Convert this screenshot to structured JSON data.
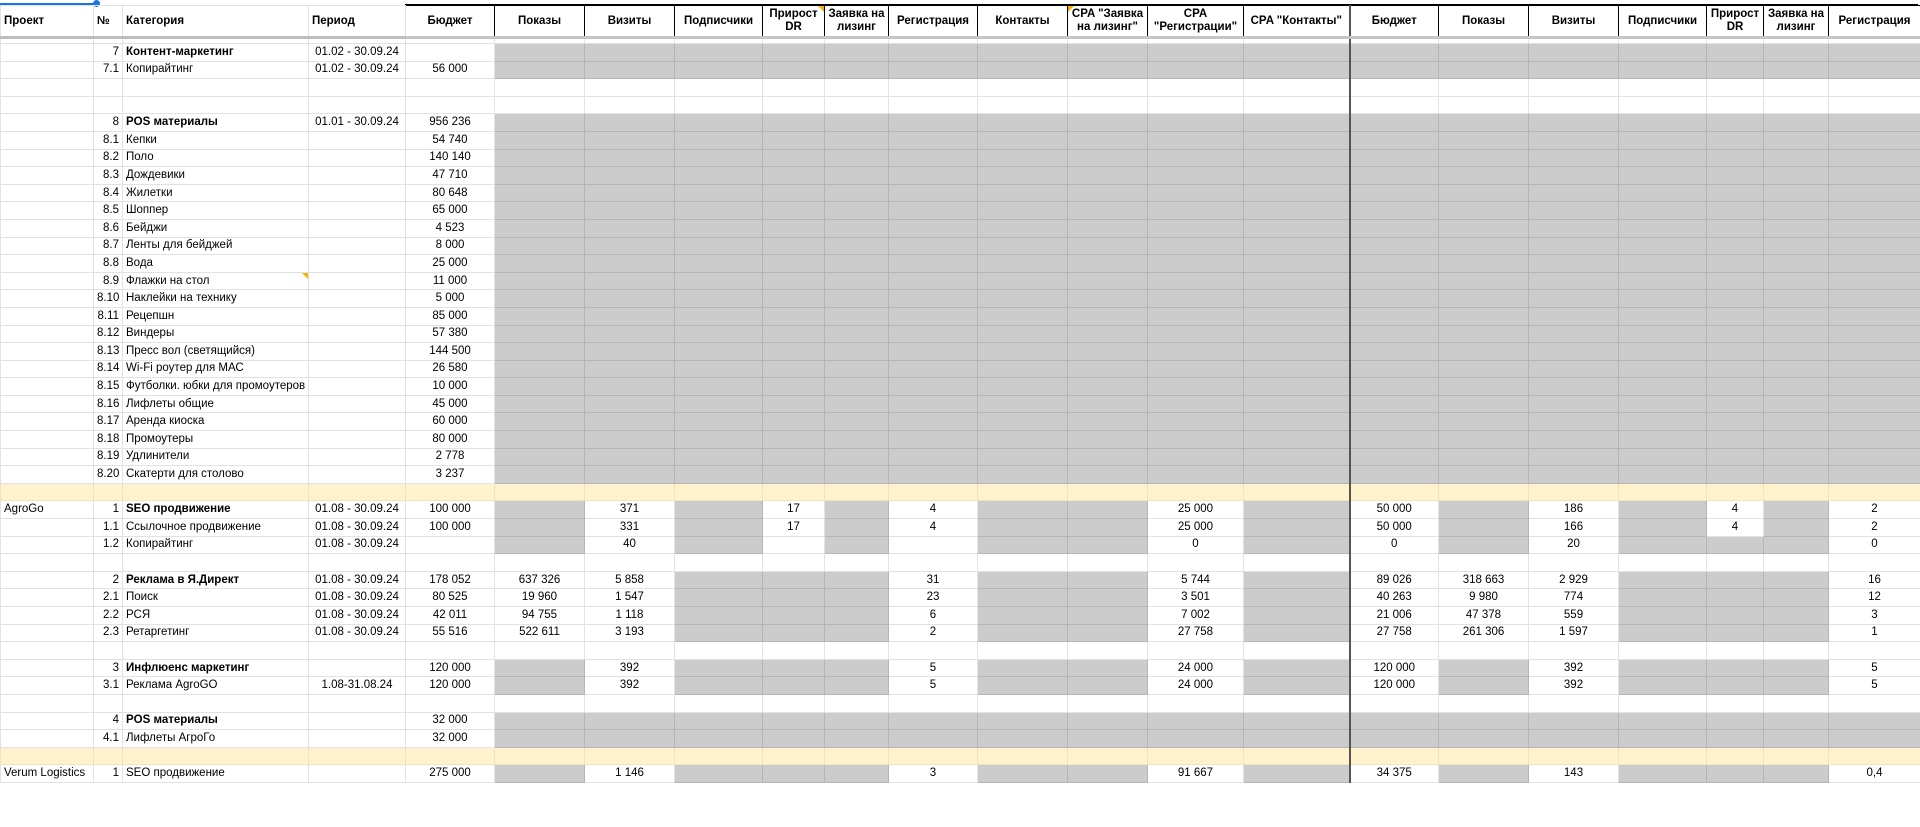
{
  "colors": {
    "shaded": "#cccccc",
    "separator": "#fff2cc",
    "selection": "#1a73e8"
  },
  "header": [
    "Проект",
    "№",
    "Категория",
    "Период",
    "Бюджет",
    "Показы",
    "Визиты",
    "Подписчики",
    "Прирост DR",
    "Заявка на лизинг",
    "Регистрация",
    "Контакты",
    "CPA \"Заявка на лизинг\"",
    "CPA \"Регистрации\"",
    "CPA \"Контакты\"",
    "Бюджет",
    "Показы",
    "Визиты",
    "Подписчики",
    "Прирост DR",
    "Заявка на лизинг",
    "Регистрация"
  ],
  "rows": [
    {
      "s": "wwwwwggggggggggggggggg",
      "b": true,
      "c": [
        "",
        "7",
        "Контент-маркетинг",
        "01.02 - 30.09.24",
        ""
      ]
    },
    {
      "s": "wwwwwggggggggggggggggg",
      "c": [
        "",
        "7.1",
        "Копирайтинг",
        "01.02 - 30.09.24",
        "56 000"
      ]
    },
    {
      "s": "wwwwwwwwwwwwwwwwwwwwww",
      "c": []
    },
    {
      "s": "wwwwwwwwwwwwwwwwwwwwww",
      "c": []
    },
    {
      "s": "wwwwwggggggggggggggggg",
      "b": true,
      "c": [
        "",
        "8",
        "POS материалы",
        "01.01 - 30.09.24",
        "956 236"
      ]
    },
    {
      "s": "wwwwwggggggggggggggggg",
      "c": [
        "",
        "8.1",
        "Кепки",
        "",
        "54 740"
      ]
    },
    {
      "s": "wwwwwggggggggggggggggg",
      "c": [
        "",
        "8.2",
        "Поло",
        "",
        "140 140"
      ]
    },
    {
      "s": "wwwwwggggggggggggggggg",
      "c": [
        "",
        "8.3",
        "Дождевики",
        "",
        "47 710"
      ]
    },
    {
      "s": "wwwwwggggggggggggggggg",
      "c": [
        "",
        "8.4",
        "Жилетки",
        "",
        "80 648"
      ]
    },
    {
      "s": "wwwwwggggggggggggggggg",
      "c": [
        "",
        "8.5",
        "Шоппер",
        "",
        "65 000"
      ]
    },
    {
      "s": "wwwwwggggggggggggggggg",
      "c": [
        "",
        "8.6",
        "Бейджи",
        "",
        "4 523"
      ]
    },
    {
      "s": "wwwwwggggggggggggggggg",
      "c": [
        "",
        "8.7",
        "Ленты для бейджей",
        "",
        "8 000"
      ]
    },
    {
      "s": "wwwwwggggggggggggggggg",
      "c": [
        "",
        "8.8",
        "Вода",
        "",
        "25 000"
      ]
    },
    {
      "s": "wwwwwggggggggggggggggg",
      "note": 2,
      "c": [
        "",
        "8.9",
        "Флажки на стол",
        "",
        "11 000"
      ]
    },
    {
      "s": "wwwwwggggggggggggggggg",
      "c": [
        "",
        "8.10",
        "Наклейки на технику",
        "",
        "5 000"
      ]
    },
    {
      "s": "wwwwwggggggggggggggggg",
      "c": [
        "",
        "8.11",
        "Рецепшн",
        "",
        "85 000"
      ]
    },
    {
      "s": "wwwwwggggggggggggggggg",
      "c": [
        "",
        "8.12",
        "Виндеры",
        "",
        "57 380"
      ]
    },
    {
      "s": "wwwwwggggggggggggggggg",
      "c": [
        "",
        "8.13",
        "Пресс вол (светящийся)",
        "",
        "144 500"
      ]
    },
    {
      "s": "wwwwwggggggggggggggggg",
      "c": [
        "",
        "8.14",
        "Wi-Fi роутер для МАС",
        "",
        "26 580"
      ]
    },
    {
      "s": "wwwwwggggggggggggggggg",
      "c": [
        "",
        "8.15",
        "Футболки. юбки для промоутеров",
        "",
        "10 000"
      ]
    },
    {
      "s": "wwwwwggggggggggggggggg",
      "c": [
        "",
        "8.16",
        "Лифлеты общие",
        "",
        "45 000"
      ]
    },
    {
      "s": "wwwwwggggggggggggggggg",
      "c": [
        "",
        "8.17",
        "Аренда киоска",
        "",
        "60 000"
      ]
    },
    {
      "s": "wwwwwggggggggggggggggg",
      "c": [
        "",
        "8.18",
        "Промоутеры",
        "",
        "80 000"
      ]
    },
    {
      "s": "wwwwwggggggggggggggggg",
      "c": [
        "",
        "8.19",
        "Удлинители",
        "",
        "2 778"
      ]
    },
    {
      "s": "wwwwwggggggggggggggggg",
      "c": [
        "",
        "8.20",
        "Скатерти для столово",
        "",
        "3 237"
      ]
    },
    {
      "s": "yyyyyyyyyyyyyyyyyyyyyy",
      "c": []
    },
    {
      "s": "wwwwwgwgwgwggwgwgwgwgw",
      "b": true,
      "c": [
        "AgroGo",
        "1",
        "SEO продвижение",
        "01.08 - 30.09.24",
        "100 000",
        "",
        "371",
        "",
        "17",
        "",
        "4",
        "",
        "",
        "25 000",
        "",
        "50 000",
        "",
        "186",
        "",
        "4",
        "",
        "2"
      ]
    },
    {
      "s": "wwwwwgwgwgwggwgwgwgwgw",
      "c": [
        "",
        "1.1",
        "Ссылочное продвижение",
        "01.08 - 30.09.24",
        "100 000",
        "",
        "331",
        "",
        "17",
        "",
        "4",
        "",
        "",
        "25 000",
        "",
        "50 000",
        "",
        "166",
        "",
        "4",
        "",
        "2"
      ]
    },
    {
      "s": "wwwwwgwgwgwggwgwgwgggw",
      "c": [
        "",
        "1.2",
        "Копирайтинг",
        "01.08 - 30.09.24",
        "",
        "",
        "40",
        "",
        "",
        "",
        "",
        "",
        "",
        "0",
        "",
        "0",
        "",
        "20",
        "",
        "",
        "",
        "0"
      ]
    },
    {
      "s": "wwwwwwwwwwwwwwwwwwwwww",
      "c": []
    },
    {
      "s": "wwwwwwwgggwggwgwwwgggw",
      "b": true,
      "c": [
        "",
        "2",
        "Реклама в Я.Директ",
        "01.08 - 30.09.24",
        "178 052",
        "637 326",
        "5 858",
        "",
        "",
        "",
        "31",
        "",
        "",
        "5 744",
        "",
        "89 026",
        "318 663",
        "2 929",
        "",
        "",
        "",
        "16"
      ]
    },
    {
      "s": "wwwwwwwgggwggwgwwwgggw",
      "c": [
        "",
        "2.1",
        "Поиск",
        "01.08 - 30.09.24",
        "80 525",
        "19 960",
        "1 547",
        "",
        "",
        "",
        "23",
        "",
        "",
        "3 501",
        "",
        "40 263",
        "9 980",
        "774",
        "",
        "",
        "",
        "12"
      ]
    },
    {
      "s": "wwwwwwwgggwggwgwwwgggw",
      "c": [
        "",
        "2.2",
        "РСЯ",
        "01.08 - 30.09.24",
        "42 011",
        "94 755",
        "1 118",
        "",
        "",
        "",
        "6",
        "",
        "",
        "7 002",
        "",
        "21 006",
        "47 378",
        "559",
        "",
        "",
        "",
        "3"
      ]
    },
    {
      "s": "wwwwwwwgggwggwgwwwgggw",
      "c": [
        "",
        "2.3",
        "Ретаргетинг",
        "01.08 - 30.09.24",
        "55 516",
        "522 611",
        "3 193",
        "",
        "",
        "",
        "2",
        "",
        "",
        "27 758",
        "",
        "27 758",
        "261 306",
        "1 597",
        "",
        "",
        "",
        "1"
      ]
    },
    {
      "s": "wwwwwwwwwwwwwwwwwwwwww",
      "c": []
    },
    {
      "s": "wwwwwgwgggwggwgwgwgggw",
      "b": true,
      "c": [
        "",
        "3",
        "Инфлюенс маркетинг",
        "",
        "120 000",
        "",
        "392",
        "",
        "",
        "",
        "5",
        "",
        "",
        "24 000",
        "",
        "120 000",
        "",
        "392",
        "",
        "",
        "",
        "5"
      ]
    },
    {
      "s": "wwwwwgwgggwggwgwgwgggw",
      "c": [
        "",
        "3.1",
        "Реклама AgroGO",
        "1.08-31.08.24",
        "120 000",
        "",
        "392",
        "",
        "",
        "",
        "5",
        "",
        "",
        "24 000",
        "",
        "120 000",
        "",
        "392",
        "",
        "",
        "",
        "5"
      ]
    },
    {
      "s": "wwwwwwwwwwwwwwwwwwwwww",
      "c": []
    },
    {
      "s": "wwwwwggggggggggggggggg",
      "b": true,
      "c": [
        "",
        "4",
        "POS материалы",
        "",
        "32 000"
      ]
    },
    {
      "s": "wwwwwggggggggggggggggg",
      "c": [
        "",
        "4.1",
        "Лифлеты АгроГо",
        "",
        "32 000"
      ]
    },
    {
      "s": "yyyyyyyyyyyyyyyyyyyyyy",
      "c": []
    },
    {
      "s": "wwwwwgwgggwggwgwgwgggw",
      "c": [
        "Verum Logistics",
        "1",
        "SEO продвижение",
        "",
        "275 000",
        "",
        "1 146",
        "",
        "",
        "",
        "3",
        "",
        "",
        "91 667",
        "",
        "34 375",
        "",
        "143",
        "",
        "",
        "",
        "0,4"
      ]
    }
  ]
}
